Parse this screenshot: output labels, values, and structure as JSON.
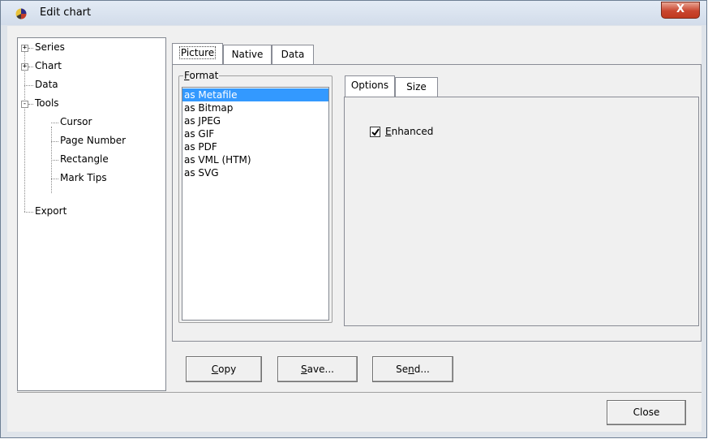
{
  "window": {
    "title": "Edit chart",
    "close_glyph": "X",
    "icon": "pie-chart-icon"
  },
  "tree": {
    "items": [
      {
        "label": "Series",
        "expander": "+"
      },
      {
        "label": "Chart",
        "expander": "+"
      },
      {
        "label": "Data"
      },
      {
        "label": "Tools",
        "expander": "-"
      },
      {
        "label": "Cursor"
      },
      {
        "label": "Page Number"
      },
      {
        "label": "Rectangle"
      },
      {
        "label": "Mark Tips"
      },
      {
        "label": "Export"
      }
    ]
  },
  "tabs": {
    "picture": "Picture",
    "native": "Native",
    "data": "Data",
    "selected": "Picture"
  },
  "format": {
    "label_first": "F",
    "label_rest": "ormat",
    "items": [
      "as Metafile",
      "as Bitmap",
      "as JPEG",
      "as GIF",
      "as PDF",
      "as VML (HTM)",
      "as SVG"
    ],
    "selected": "as Metafile"
  },
  "subtabs": {
    "options": "Options",
    "size": "Size",
    "selected": "Options"
  },
  "options": {
    "enhanced_first": "E",
    "enhanced_rest": "nhanced",
    "enhanced_checked": true
  },
  "buttons": {
    "copy_first": "C",
    "copy_rest": "opy",
    "save_first": "S",
    "save_rest": "ave...",
    "send_pre": "Se",
    "send_mnemonic": "n",
    "send_rest": "d...",
    "close": "Close"
  },
  "colors": {
    "selection": "#3399ff",
    "close_button": "#c9462f"
  }
}
